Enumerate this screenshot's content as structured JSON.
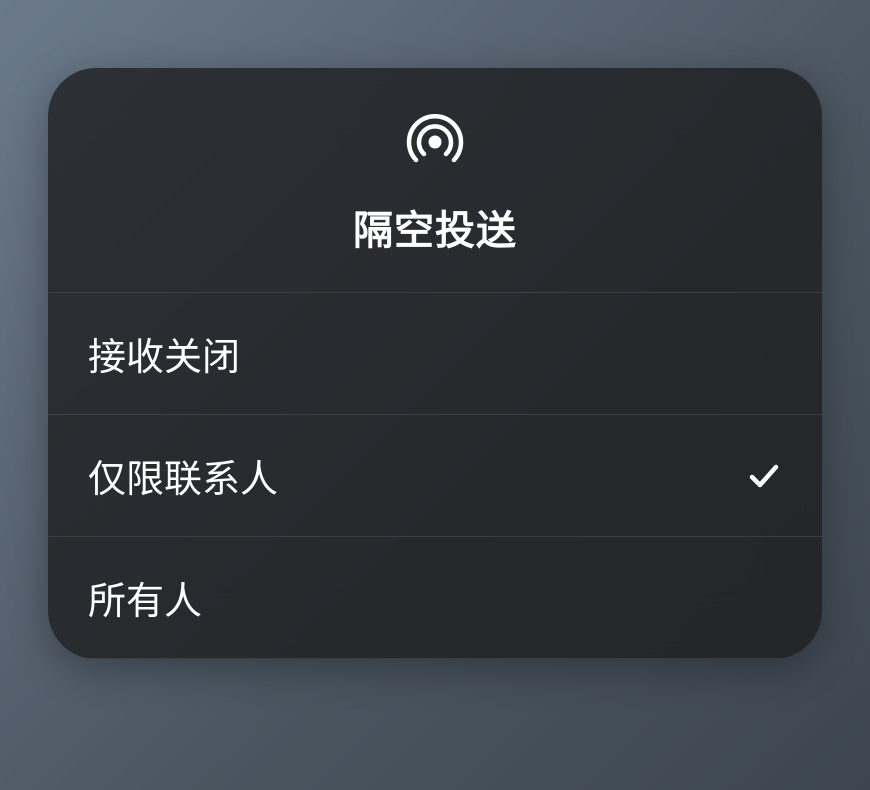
{
  "header": {
    "icon": "airdrop-icon",
    "title": "隔空投送"
  },
  "options": [
    {
      "label": "接收关闭",
      "selected": false
    },
    {
      "label": "仅限联系人",
      "selected": true
    },
    {
      "label": "所有人",
      "selected": false
    }
  ]
}
